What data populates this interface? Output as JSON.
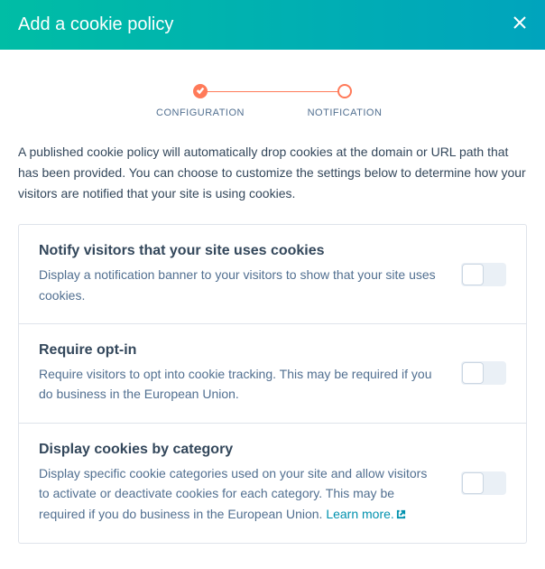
{
  "header": {
    "title": "Add a cookie policy"
  },
  "stepper": {
    "steps": [
      {
        "label": "CONFIGURATION"
      },
      {
        "label": "NOTIFICATION"
      }
    ]
  },
  "description": "A published cookie policy will automatically drop cookies at the domain or URL path that has been provided. You can choose to customize the settings below to determine how your visitors are notified that your site is using cookies.",
  "options": [
    {
      "title": "Notify visitors that your site uses cookies",
      "desc": "Display a notification banner to your visitors to show that your site uses cookies."
    },
    {
      "title": "Require opt-in",
      "desc": "Require visitors to opt into cookie tracking. This may be required if you do business in the European Union."
    },
    {
      "title": "Display cookies by category",
      "desc": "Display specific cookie categories used on your site and allow visitors to activate or deactivate cookies for each category. This may be required if you do business in the European Union. ",
      "learn_more": "Learn more."
    }
  ]
}
